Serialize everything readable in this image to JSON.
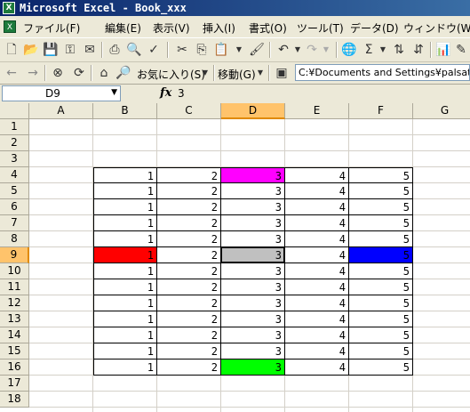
{
  "window": {
    "title": "Microsoft Excel - Book_xxx",
    "app_icon": "excel-icon"
  },
  "menubar": {
    "doc_icon": "excel-doc-icon",
    "items": [
      {
        "label": "ファイル(F)"
      },
      {
        "label": "編集(E)"
      },
      {
        "label": "表示(V)"
      },
      {
        "label": "挿入(I)"
      },
      {
        "label": "書式(O)"
      },
      {
        "label": "ツール(T)"
      },
      {
        "label": "データ(D)"
      },
      {
        "label": "ウィンドウ(W)"
      }
    ]
  },
  "toolbar": {
    "standard_icons": [
      "new-icon",
      "open-icon",
      "save-icon",
      "permission-icon",
      "email-icon",
      "print-icon",
      "print-preview-icon",
      "spelling-icon",
      "cut-icon",
      "copy-icon",
      "paste-icon",
      "format-painter-icon",
      "undo-icon",
      "redo-icon",
      "hyperlink-icon",
      "autosum-icon",
      "sort-ascending-icon",
      "sort-descending-icon",
      "chart-wizard-icon"
    ],
    "web_icons": [
      "back-icon",
      "forward-icon",
      "stop-icon",
      "refresh-icon",
      "home-icon",
      "search-web-icon"
    ],
    "favorites_label": "お気に入り(S)",
    "go_label": "移動(G)",
    "address": "C:¥Documents and Settings¥palsation"
  },
  "formula_bar": {
    "name_box": "D9",
    "fx_label": "fx",
    "value": "3"
  },
  "sheet": {
    "columns": [
      "A",
      "B",
      "C",
      "D",
      "E",
      "F",
      "G"
    ],
    "selected_column": "D",
    "selected_row": "9",
    "rows": [
      {
        "label": "1",
        "cells": [
          "",
          "",
          "",
          "",
          "",
          "",
          ""
        ]
      },
      {
        "label": "2",
        "cells": [
          "",
          "",
          "",
          "",
          "",
          "",
          ""
        ]
      },
      {
        "label": "3",
        "cells": [
          "",
          "",
          "",
          "",
          "",
          "",
          ""
        ]
      },
      {
        "label": "4",
        "cells": [
          "",
          "1",
          "2",
          "3",
          "4",
          "5",
          ""
        ]
      },
      {
        "label": "5",
        "cells": [
          "",
          "1",
          "2",
          "3",
          "4",
          "5",
          ""
        ]
      },
      {
        "label": "6",
        "cells": [
          "",
          "1",
          "2",
          "3",
          "4",
          "5",
          ""
        ]
      },
      {
        "label": "7",
        "cells": [
          "",
          "1",
          "2",
          "3",
          "4",
          "5",
          ""
        ]
      },
      {
        "label": "8",
        "cells": [
          "",
          "1",
          "2",
          "3",
          "4",
          "5",
          ""
        ]
      },
      {
        "label": "9",
        "cells": [
          "",
          "1",
          "2",
          "3",
          "4",
          "5",
          ""
        ]
      },
      {
        "label": "10",
        "cells": [
          "",
          "1",
          "2",
          "3",
          "4",
          "5",
          ""
        ]
      },
      {
        "label": "11",
        "cells": [
          "",
          "1",
          "2",
          "3",
          "4",
          "5",
          ""
        ]
      },
      {
        "label": "12",
        "cells": [
          "",
          "1",
          "2",
          "3",
          "4",
          "5",
          ""
        ]
      },
      {
        "label": "13",
        "cells": [
          "",
          "1",
          "2",
          "3",
          "4",
          "5",
          ""
        ]
      },
      {
        "label": "14",
        "cells": [
          "",
          "1",
          "2",
          "3",
          "4",
          "5",
          ""
        ]
      },
      {
        "label": "15",
        "cells": [
          "",
          "1",
          "2",
          "3",
          "4",
          "5",
          ""
        ]
      },
      {
        "label": "16",
        "cells": [
          "",
          "1",
          "2",
          "3",
          "4",
          "5",
          ""
        ]
      },
      {
        "label": "17",
        "cells": [
          "",
          "",
          "",
          "",
          "",
          "",
          ""
        ]
      },
      {
        "label": "18",
        "cells": [
          "",
          "",
          "",
          "",
          "",
          "",
          ""
        ]
      }
    ],
    "fills": {
      "D4": "#ff00ff",
      "B9": "#ff0000",
      "D9": "#c0c0c0",
      "F9": "#0000ff",
      "D16": "#00ff00"
    },
    "active_cell": "D9"
  }
}
